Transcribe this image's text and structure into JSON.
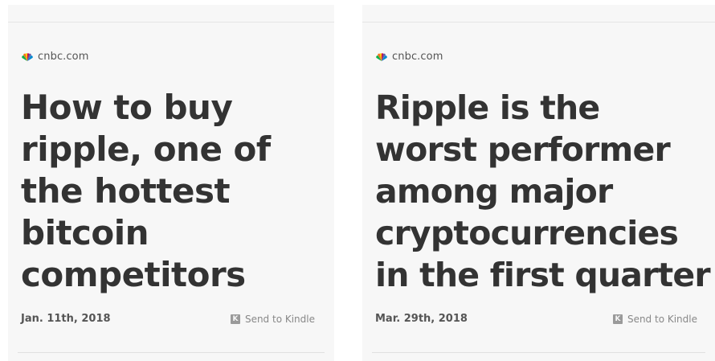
{
  "cards": [
    {
      "source": "cnbc.com",
      "headline_lines": [
        "How to buy",
        "ripple, one of",
        "the hottest",
        "bitcoin",
        "competitors"
      ],
      "date": "Jan. 11th, 2018",
      "kindle_label": "Send to Kindle",
      "kindle_icon": "K"
    },
    {
      "source": "cnbc.com",
      "headline_lines": [
        "Ripple is the",
        "worst performer",
        "among major",
        "cryptocurrencies",
        "in the first quarter"
      ],
      "date": "Mar. 29th, 2018",
      "kindle_label": "Send to Kindle",
      "kindle_icon": "K"
    }
  ],
  "colors": {
    "card_bg": "#f7f7f7",
    "headline": "#333333",
    "meta": "#555555",
    "peacock": [
      "#fccc0a",
      "#f37021",
      "#cc004c",
      "#6460aa",
      "#0089d0",
      "#0db14b"
    ]
  }
}
